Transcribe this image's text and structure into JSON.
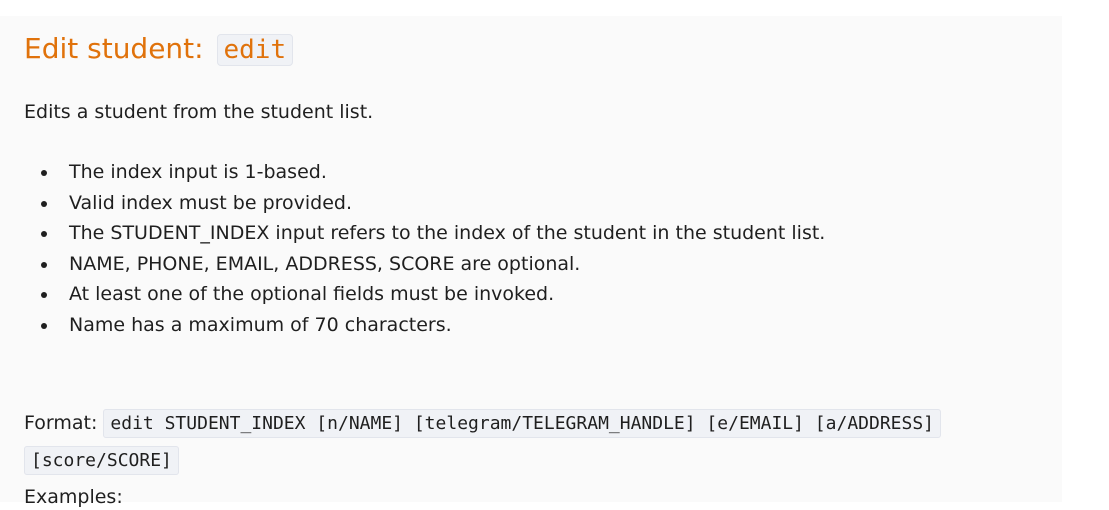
{
  "section": {
    "title_text": "Edit student:",
    "title_command": "edit",
    "description": "Edits a student from the student list.",
    "rules": [
      "The index input is 1-based.",
      "Valid index must be provided.",
      "The STUDENT_INDEX input refers to the index of the student in the student list.",
      "NAME, PHONE, EMAIL, ADDRESS, SCORE are optional.",
      "At least one of the optional fields must be invoked.",
      "Name has a maximum of 70 characters."
    ],
    "format_label": "Format:",
    "format_command": "edit STUDENT_INDEX [n/NAME] [telegram/TELEGRAM_HANDLE] [e/EMAIL] [a/ADDRESS] [score/SCORE]",
    "examples_label": "Examples:"
  },
  "colors": {
    "heading": "#e0720b",
    "text": "#1f1f1f",
    "code_background": "#f0f2f6",
    "panel_background": "#fafafa"
  }
}
